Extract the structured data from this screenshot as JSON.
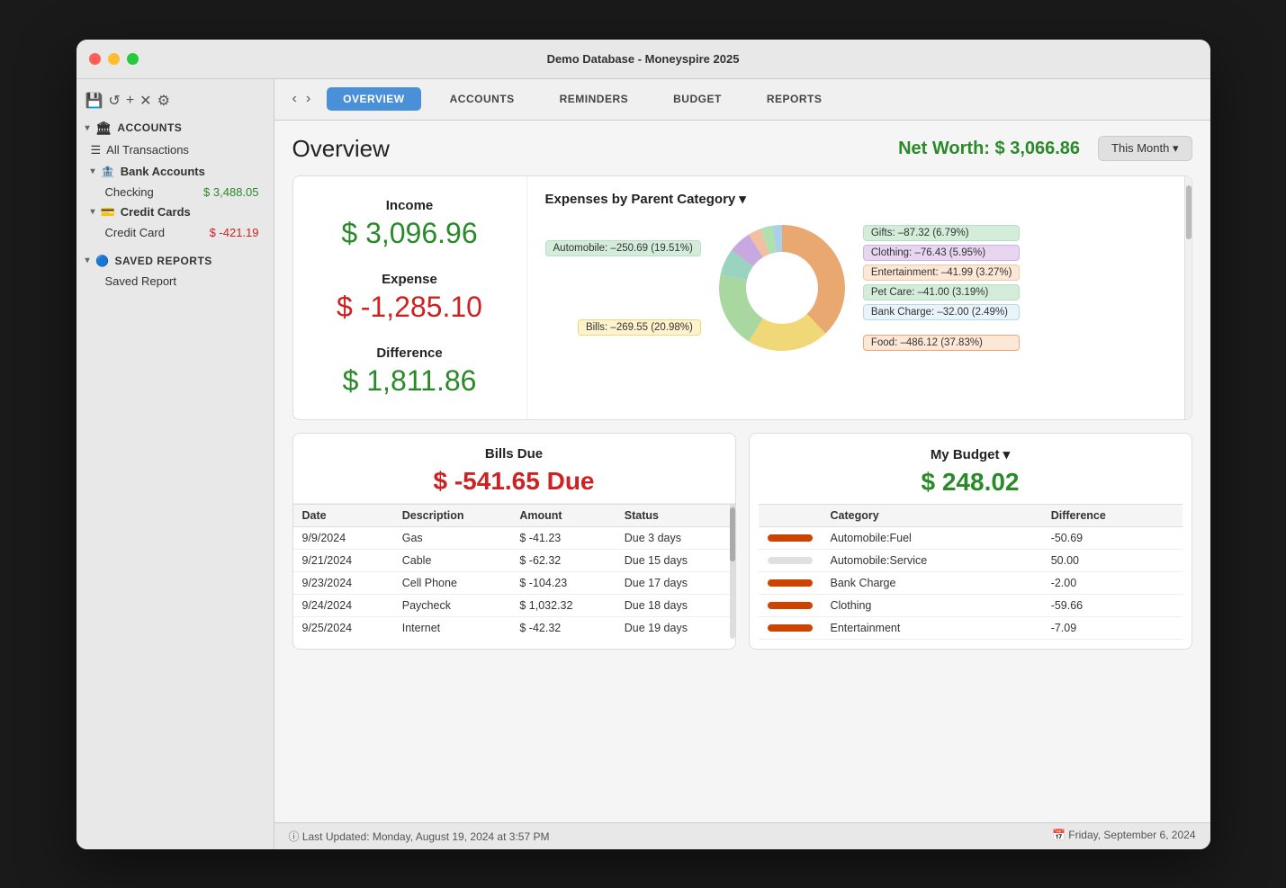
{
  "window": {
    "title": "Demo Database - Moneyspire 2025",
    "traffic_lights": [
      "close",
      "minimize",
      "maximize"
    ]
  },
  "sidebar": {
    "toolbar": {
      "save_icon": "💾",
      "refresh_icon": "↺",
      "add_icon": "+",
      "tools_icon": "✕",
      "settings_icon": "⚙"
    },
    "sections": [
      {
        "name": "ACCOUNTS",
        "icon": "🏛",
        "items": [
          {
            "label": "All Transactions",
            "type": "link"
          },
          {
            "label": "Bank Accounts",
            "type": "group",
            "children": [
              {
                "label": "Checking",
                "amount": "$ 3,488.05",
                "positive": true
              }
            ]
          },
          {
            "label": "Credit Cards",
            "type": "group",
            "children": [
              {
                "label": "Credit Card",
                "amount": "$ -421.19",
                "positive": false
              }
            ]
          }
        ]
      },
      {
        "name": "SAVED REPORTS",
        "icon": "🔵",
        "items": [
          {
            "label": "Saved Report",
            "type": "link"
          }
        ]
      }
    ]
  },
  "navbar": {
    "back_arrow": "‹",
    "forward_arrow": "›",
    "tabs": [
      {
        "label": "OVERVIEW",
        "active": true
      },
      {
        "label": "ACCOUNTS",
        "active": false
      },
      {
        "label": "REMINDERS",
        "active": false
      },
      {
        "label": "BUDGET",
        "active": false
      },
      {
        "label": "REPORTS",
        "active": false
      }
    ]
  },
  "overview": {
    "title": "Overview",
    "net_worth_label": "Net Worth:",
    "net_worth_value": "$ 3,066.86",
    "period_button": "This Month ▾",
    "summary": {
      "income_label": "Income",
      "income_value": "$ 3,096.96",
      "expense_label": "Expense",
      "expense_value": "$ -1,285.10",
      "difference_label": "Difference",
      "difference_value": "$ 1,811.86"
    },
    "chart": {
      "title": "Expenses by Parent Category ▾",
      "segments": [
        {
          "label": "Food: –486.12 (37.83%)",
          "color": "#e8a870",
          "pct": 37.83
        },
        {
          "label": "Bills: –269.55 (20.98%)",
          "color": "#f0d878",
          "pct": 20.98
        },
        {
          "label": "Automobile: –250.69 (19.51%)",
          "color": "#a8d8a0",
          "pct": 19.51
        },
        {
          "label": "Gifts: –87.32 (6.79%)",
          "color": "#98d4c0",
          "pct": 6.79
        },
        {
          "label": "Clothing: –76.43 (5.95%)",
          "color": "#c8a8e0",
          "pct": 5.95
        },
        {
          "label": "Entertainment: –41.99 (3.27%)",
          "color": "#f0c0a0",
          "pct": 3.27
        },
        {
          "label": "Pet Care: –41.00 (3.19%)",
          "color": "#b0e0b0",
          "pct": 3.19
        },
        {
          "label": "Bank Charge: –32.00 (2.49%)",
          "color": "#a8d0e8",
          "pct": 2.49
        }
      ]
    },
    "bills": {
      "title": "Bills Due",
      "total": "$ -541.65 Due",
      "columns": [
        "Date",
        "Description",
        "Amount",
        "Status"
      ],
      "rows": [
        {
          "date": "9/9/2024",
          "description": "Gas",
          "amount": "$ -41.23",
          "status": "Due 3 days",
          "amount_positive": false
        },
        {
          "date": "9/21/2024",
          "description": "Cable",
          "amount": "$ -62.32",
          "status": "Due 15 days",
          "amount_positive": false
        },
        {
          "date": "9/23/2024",
          "description": "Cell Phone",
          "amount": "$ -104.23",
          "status": "Due 17 days",
          "amount_positive": false
        },
        {
          "date": "9/24/2024",
          "description": "Paycheck",
          "amount": "$ 1,032.32",
          "status": "Due 18 days",
          "amount_positive": true
        },
        {
          "date": "9/25/2024",
          "description": "Internet",
          "amount": "$ -42.32",
          "status": "Due 19 days",
          "amount_positive": false
        }
      ]
    },
    "budget": {
      "title": "My Budget ▾",
      "total": "$ 248.02",
      "columns": [
        "Category",
        "Difference"
      ],
      "rows": [
        {
          "category": "Automobile:Fuel",
          "difference": "-50.69",
          "positive": false,
          "bar_fill": true
        },
        {
          "category": "Automobile:Service",
          "difference": "50.00",
          "positive": true,
          "bar_fill": false
        },
        {
          "category": "Bank Charge",
          "difference": "-2.00",
          "positive": false,
          "bar_fill": true
        },
        {
          "category": "Clothing",
          "difference": "-59.66",
          "positive": false,
          "bar_fill": true
        },
        {
          "category": "Entertainment",
          "difference": "-7.09",
          "positive": false,
          "bar_fill": true
        }
      ]
    }
  },
  "status_bar": {
    "last_updated": "ⓘ  Last Updated: Monday, August 19, 2024 at 3:57 PM",
    "current_date": "📅  Friday, September 6, 2024"
  }
}
